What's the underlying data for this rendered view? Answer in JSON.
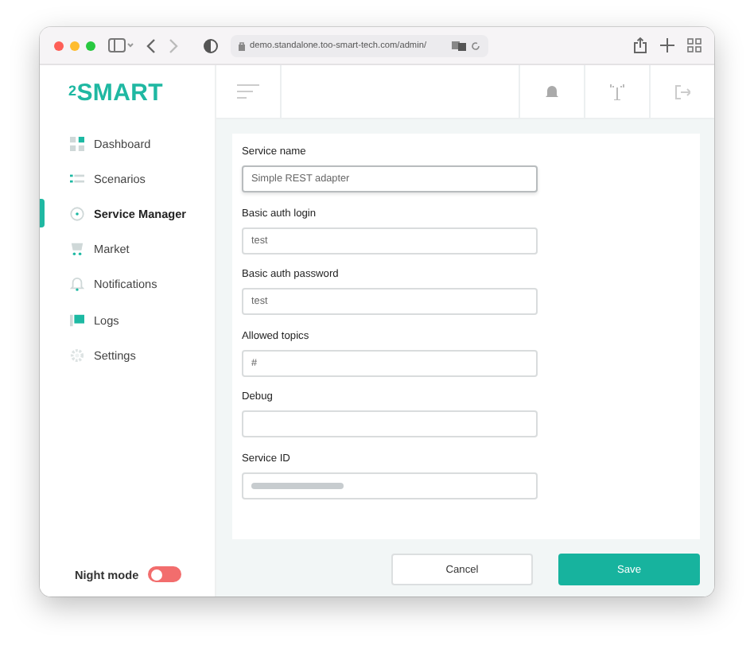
{
  "browser": {
    "address": "demo.standalone.too-smart-tech.com/admin/"
  },
  "logo": "$^{2}$SMART",
  "sidebar": {
    "items": [
      {
        "label": "Dashboard",
        "kind": "dashboard",
        "selected": false
      },
      {
        "label": "Scenarios",
        "kind": "scenarios",
        "selected": false
      },
      {
        "label": "Service Manager",
        "kind": "service",
        "selected": true
      },
      {
        "label": "Market",
        "kind": "market",
        "selected": false
      },
      {
        "label": "Notifications",
        "kind": "bell",
        "selected": false
      },
      {
        "label": "Logs",
        "kind": "logs",
        "selected": false
      },
      {
        "label": "Settings",
        "kind": "gear",
        "selected": false
      }
    ],
    "night_mode": {
      "label": "Night mode",
      "on": false
    }
  },
  "form": {
    "fields": [
      {
        "label": "Service name",
        "value": "Simple REST adapter",
        "focused": true
      },
      {
        "label": "Basic auth login",
        "value": "test",
        "focused": false
      },
      {
        "label": "Basic auth password",
        "value": "test",
        "focused": false
      },
      {
        "label": "Allowed topics",
        "value": "#",
        "focused": false
      },
      {
        "label": "Debug",
        "focused": false
      },
      {
        "label": "Service ID",
        "kind": "blurred",
        "focused": false
      }
    ]
  },
  "buttons": [
    {
      "label": "Cancel",
      "kind": "secondary"
    },
    {
      "label": "Save",
      "kind": "primary"
    }
  ]
}
